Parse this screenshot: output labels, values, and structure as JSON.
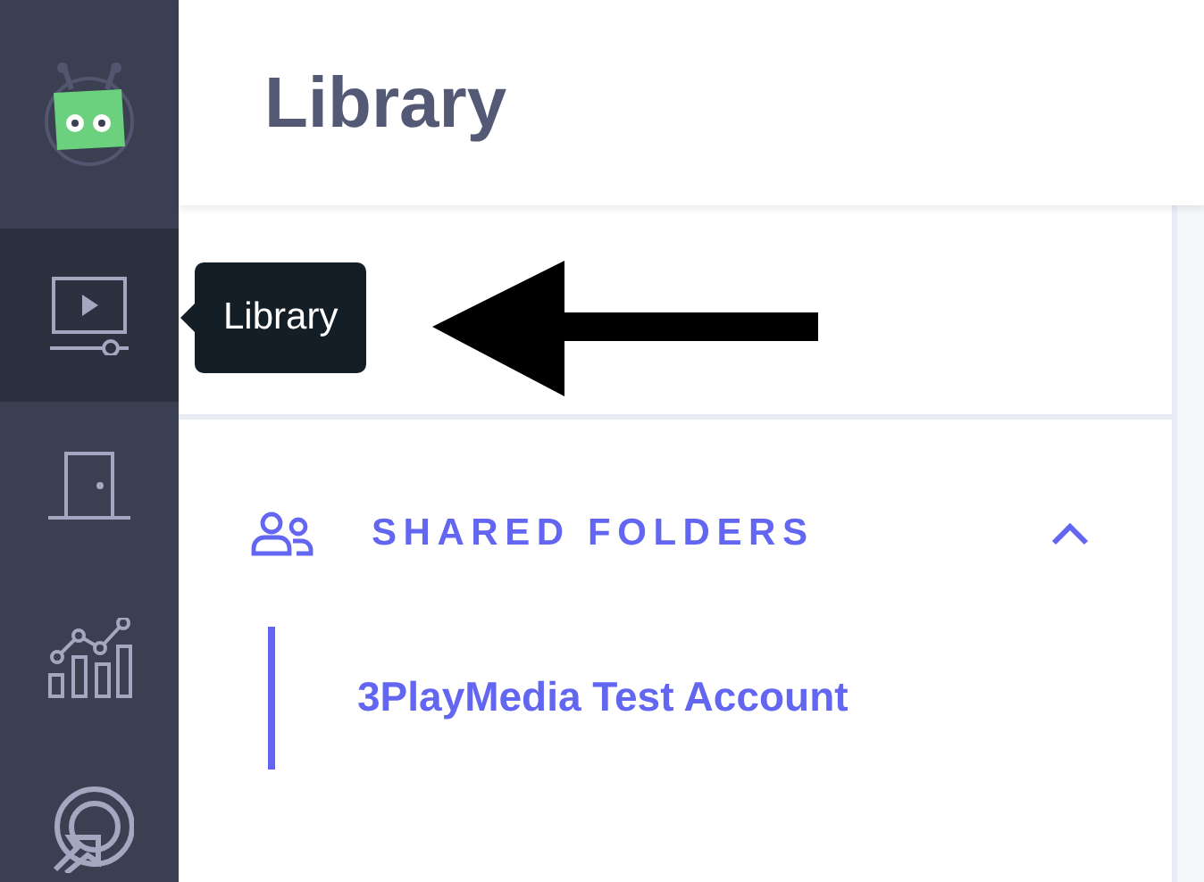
{
  "sidebar": {
    "items": [
      {
        "kind": "logo",
        "selected": false
      },
      {
        "kind": "library",
        "selected": true
      },
      {
        "kind": "door",
        "selected": false
      },
      {
        "kind": "analytics",
        "selected": false
      },
      {
        "kind": "target",
        "selected": false
      }
    ]
  },
  "tooltip": {
    "text": "Library"
  },
  "page": {
    "title": "Library"
  },
  "shared_folders": {
    "title": "SHARED FOLDERS",
    "expanded": true,
    "items": [
      {
        "label": "3PlayMedia Test Account"
      }
    ]
  }
}
